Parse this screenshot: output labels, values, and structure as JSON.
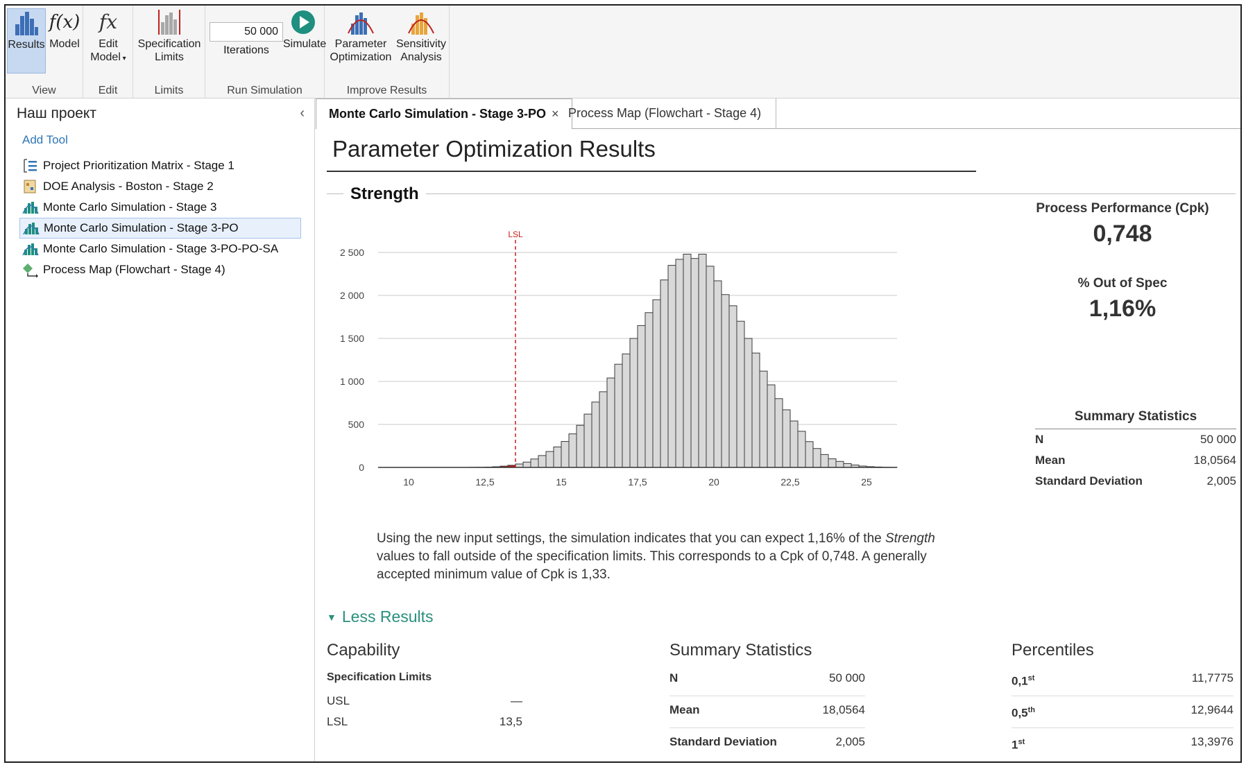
{
  "ribbon": {
    "groups": [
      {
        "label": "View",
        "buttons": [
          "Results",
          "Model"
        ]
      },
      {
        "label": "Edit",
        "buttons": [
          "Edit\nModel"
        ]
      },
      {
        "label": "Limits",
        "buttons": [
          "Specification\nLimits"
        ]
      },
      {
        "label": "Run Simulation",
        "buttons": [
          "Iterations",
          "Simulate"
        ]
      },
      {
        "label": "Improve Results",
        "buttons": [
          "Parameter\nOptimization",
          "Sensitivity\nAnalysis"
        ]
      }
    ],
    "results_label": "Results",
    "model_label": "Model",
    "model_icon_text": "f(x)",
    "edit_model_label1": "Edit",
    "edit_model_label2": "Model",
    "edit_model_icon_text": "fx",
    "spec_limits_label1": "Specification",
    "spec_limits_label2": "Limits",
    "iterations_value": "50 000",
    "iterations_label": "Iterations",
    "simulate_label": "Simulate",
    "param_opt_label1": "Parameter",
    "param_opt_label2": "Optimization",
    "sens_label1": "Sensitivity",
    "sens_label2": "Analysis",
    "group_view": "View",
    "group_edit": "Edit",
    "group_limits": "Limits",
    "group_run": "Run Simulation",
    "group_improve": "Improve Results"
  },
  "sidebar": {
    "title": "Наш проект",
    "collapse_glyph": "‹",
    "add_tool": "Add Tool",
    "items": [
      {
        "label": "Project Prioritization Matrix  - Stage 1",
        "icon": "matrix-icon"
      },
      {
        "label": "DOE Analysis - Boston  - Stage 2",
        "icon": "doe-icon"
      },
      {
        "label": "Monte Carlo Simulation - Stage 3",
        "icon": "monte-carlo-icon"
      },
      {
        "label": "Monte Carlo Simulation - Stage 3-PO",
        "icon": "monte-carlo-icon"
      },
      {
        "label": "Monte Carlo Simulation - Stage 3-PO-PO-SA",
        "icon": "monte-carlo-icon"
      },
      {
        "label": "Process Map (Flowchart - Stage 4)",
        "icon": "process-map-icon"
      }
    ]
  },
  "tabs": [
    {
      "label": "Monte Carlo Simulation - Stage 3-PO",
      "close": "×",
      "active": true
    },
    {
      "label": "Process Map (Flowchart - Stage 4)",
      "active": false
    }
  ],
  "main": {
    "title": "Parameter Optimization Results",
    "section": "Strength",
    "desc_before": "Using the new input settings, the simulation indicates that you can expect 1,16% of the ",
    "desc_italic": "Strength",
    "desc_after": " values to fall outside of the specification limits. This corresponds to a Cpk of 0,748. A generally accepted minimum value of Cpk is 1,33.",
    "cpk_label": "Process Performance (Cpk)",
    "cpk_value": "0,748",
    "oos_label": "% Out of Spec",
    "oos_value": "1,16%",
    "summary_title": "Summary Statistics",
    "summary": [
      {
        "k": "N",
        "v": "50 000"
      },
      {
        "k": "Mean",
        "v": "18,0564"
      },
      {
        "k": "Standard Deviation",
        "v": "2,005"
      }
    ],
    "less_results": "Less Results",
    "capability": {
      "title": "Capability",
      "sub": "Specification Limits",
      "rows": [
        {
          "k": "USL",
          "v": "—"
        },
        {
          "k": "LSL",
          "v": "13,5"
        }
      ]
    },
    "summary_bottom": {
      "title": "Summary Statistics",
      "rows": [
        {
          "k": "N",
          "v": "50 000"
        },
        {
          "k": "Mean",
          "v": "18,0564"
        },
        {
          "k": "Standard Deviation",
          "v": "2,005"
        }
      ]
    },
    "percentiles": {
      "title": "Percentiles",
      "rows": [
        {
          "k": "0,1",
          "sup": "st",
          "v": "11,7775"
        },
        {
          "k": "0,5",
          "sup": "th",
          "v": "12,9644"
        },
        {
          "k": "1",
          "sup": "st",
          "v": "13,3976"
        }
      ]
    }
  },
  "chart_data": {
    "type": "bar",
    "title": "",
    "xlabel": "",
    "ylabel": "",
    "xlim": [
      9,
      26
    ],
    "ylim": [
      0,
      2500
    ],
    "x_ticks": [
      10,
      12.5,
      15,
      17.5,
      20,
      22.5,
      25
    ],
    "x_tick_labels": [
      "10",
      "12,5",
      "15",
      "17,5",
      "20",
      "22,5",
      "25"
    ],
    "y_ticks": [
      0,
      500,
      1000,
      1500,
      2000,
      2500
    ],
    "y_tick_labels": [
      "0",
      "500",
      "1 000",
      "1 500",
      "2 000",
      "2 500"
    ],
    "bin_width": 0.25,
    "bin_start": 9.5,
    "values": [
      0,
      0,
      0,
      0,
      0,
      0,
      0,
      0,
      0,
      0,
      1,
      2,
      4,
      8,
      15,
      25,
      40,
      62,
      98,
      138,
      185,
      238,
      302,
      390,
      490,
      620,
      760,
      880,
      1040,
      1200,
      1320,
      1500,
      1650,
      1800,
      1950,
      2180,
      2350,
      2420,
      2480,
      2430,
      2480,
      2340,
      2170,
      2010,
      1880,
      1700,
      1500,
      1330,
      1120,
      960,
      800,
      670,
      540,
      420,
      300,
      220,
      150,
      100,
      70,
      45,
      28,
      16,
      9,
      5,
      2,
      1,
      0,
      0
    ],
    "lsl": 13.5,
    "lsl_label": "LSL",
    "out_of_spec_color": "#c0211c",
    "in_spec_color": "#d9d9d9",
    "lsl_color": "#c0211c",
    "grid": true
  }
}
